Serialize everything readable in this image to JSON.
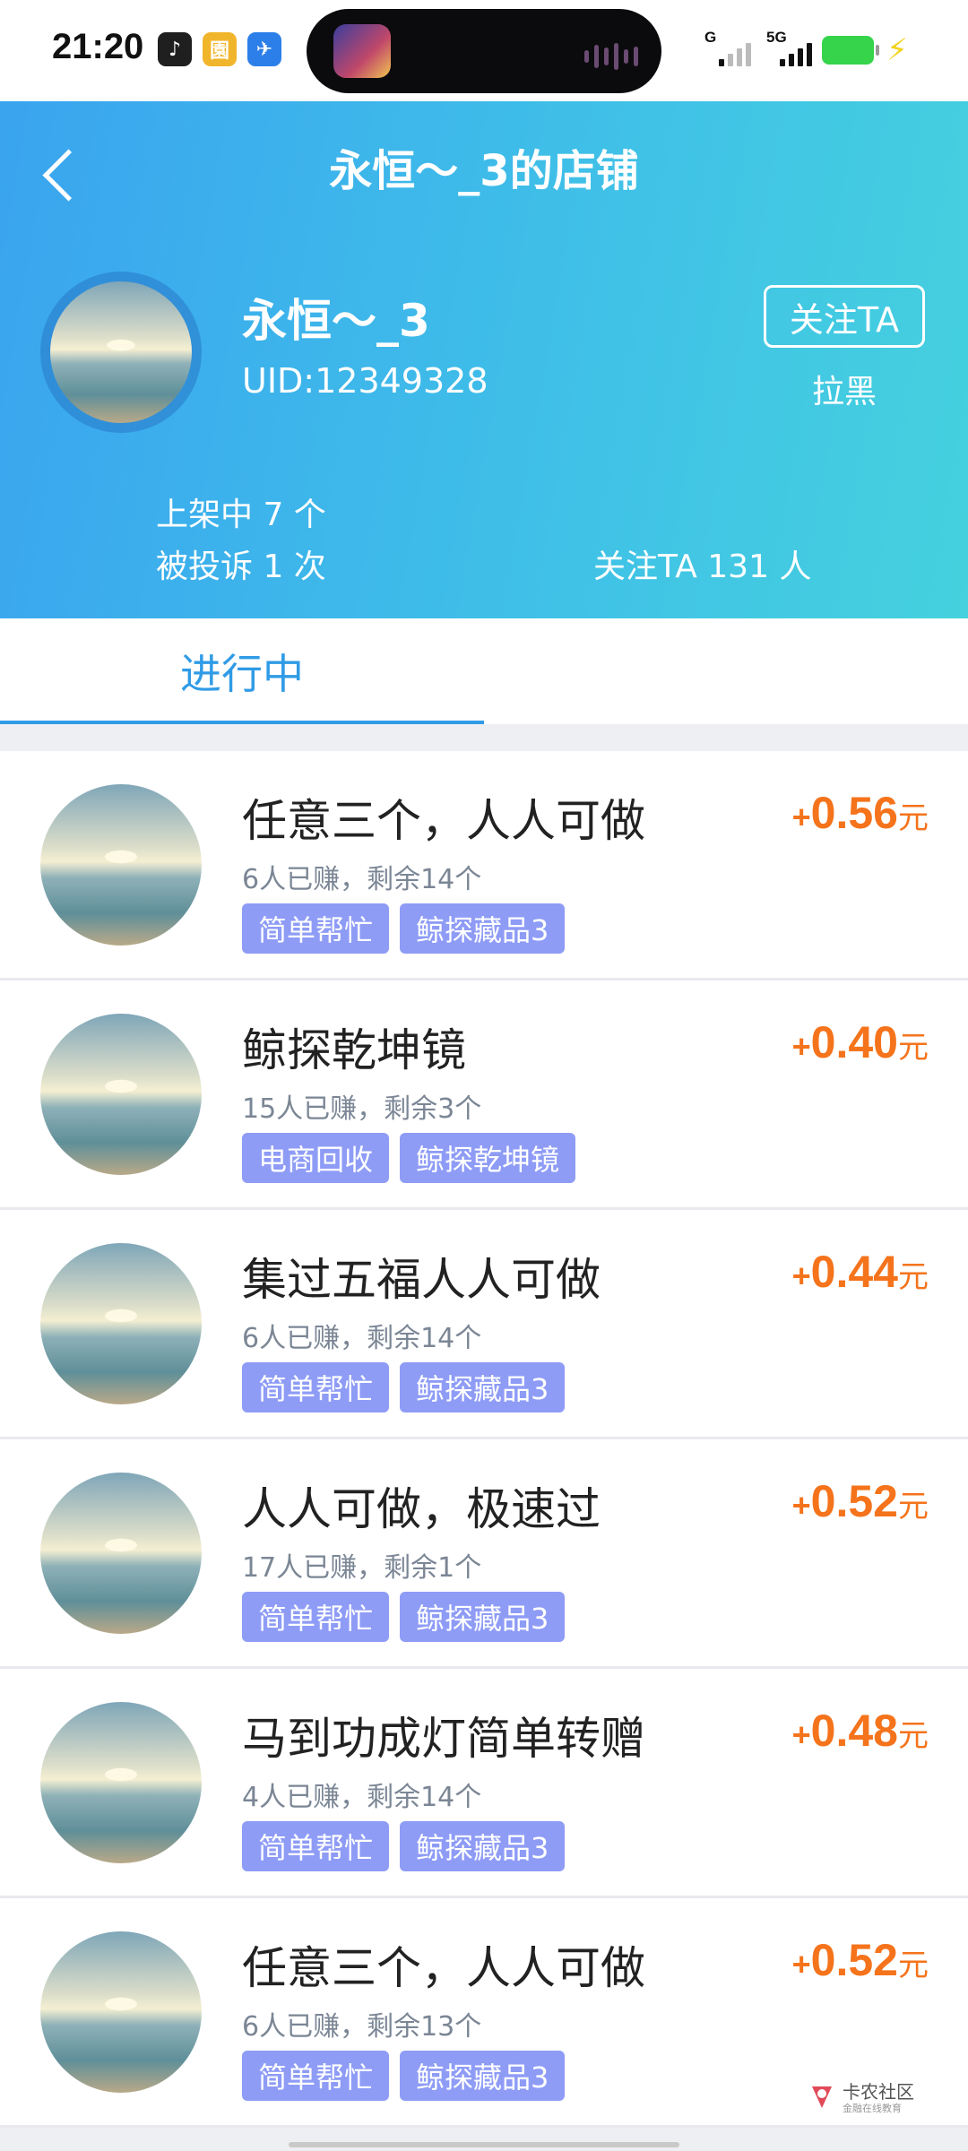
{
  "status_bar": {
    "time": "21:20",
    "apps": [
      {
        "icon": "music-app-icon",
        "glyph": "♪",
        "color": "#1f1f1f"
      },
      {
        "icon": "garden-app-icon",
        "glyph": "園",
        "color": "#f1b52c"
      },
      {
        "icon": "bird-app-icon",
        "glyph": "✈",
        "color": "#2c7fe8"
      }
    ],
    "sim1_label": "G",
    "sim2_label": "5G"
  },
  "header": {
    "title": "永恒～_3的店铺",
    "username": "永恒～_3",
    "uid": "UID:12349328",
    "follow_label": "关注TA",
    "block_label": "拉黑",
    "on_shelf": "上架中 7 个",
    "complaints": "被投诉 1 次",
    "followers": "关注TA 131 人"
  },
  "tabs": [
    {
      "label": "进行中",
      "active": true
    }
  ],
  "tasks": [
    {
      "title": "任意三个，人人可做",
      "meta": "6人已赚，剩余14个",
      "tags": [
        "简单帮忙",
        "鲸探藏品3"
      ],
      "price": "0.56",
      "plus": "+",
      "unit": "元"
    },
    {
      "title": "鲸探乾坤镜",
      "meta": "15人已赚，剩余3个",
      "tags": [
        "电商回收",
        "鲸探乾坤镜"
      ],
      "price": "0.40",
      "plus": "+",
      "unit": "元"
    },
    {
      "title": "集过五福人人可做",
      "meta": "6人已赚，剩余14个",
      "tags": [
        "简单帮忙",
        "鲸探藏品3"
      ],
      "price": "0.44",
      "plus": "+",
      "unit": "元"
    },
    {
      "title": "人人可做，极速过",
      "meta": "17人已赚，剩余1个",
      "tags": [
        "简单帮忙",
        "鲸探藏品3"
      ],
      "price": "0.52",
      "plus": "+",
      "unit": "元"
    },
    {
      "title": "马到功成灯简单转赠",
      "meta": "4人已赚，剩余14个",
      "tags": [
        "简单帮忙",
        "鲸探藏品3"
      ],
      "price": "0.48",
      "plus": "+",
      "unit": "元"
    },
    {
      "title": "任意三个，人人可做",
      "meta": "6人已赚，剩余13个",
      "tags": [
        "简单帮忙",
        "鲸探藏品3"
      ],
      "price": "0.52",
      "plus": "+",
      "unit": "元"
    }
  ],
  "watermark": {
    "text": "卡农社区",
    "sub": "金融在线教育"
  },
  "colors": {
    "header_start": "#3aa4ef",
    "header_end": "#45d1de",
    "accent": "#2f9be6",
    "price": "#f5731b",
    "tag": "#8e9cf6"
  }
}
